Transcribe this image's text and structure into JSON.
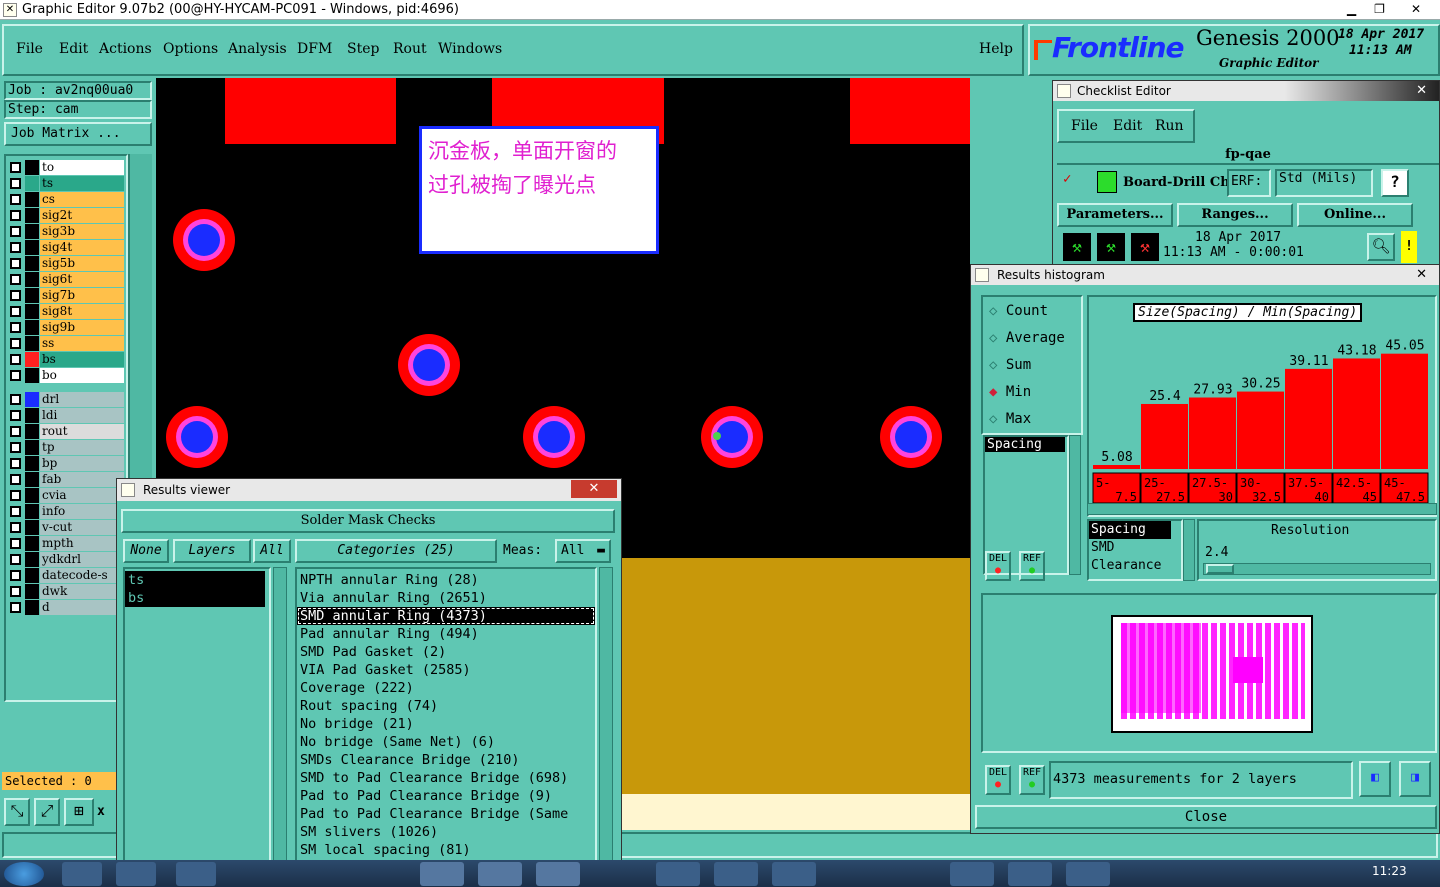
{
  "window": {
    "title": "Graphic Editor 9.07b2 (00@HY-HYCAM-PC091 - Windows, pid:4696)"
  },
  "menu": {
    "file": "File",
    "edit": "Edit",
    "actions": "Actions",
    "options": "Options",
    "analysis": "Analysis",
    "dfm": "DFM",
    "step": "Step",
    "rout": "Rout",
    "windows": "Windows",
    "help": "Help"
  },
  "brand": {
    "logo": "Frontline",
    "product": "Genesis 2000",
    "subtitle": "Graphic Editor",
    "date": "18 Apr 2017",
    "time": "11:13 AM"
  },
  "job": {
    "job_line": "Job : av2nq00ua0",
    "step_line": "Step: cam",
    "matrix_button": "Job Matrix ..."
  },
  "layers": {
    "group1": [
      {
        "name": "to",
        "color": "#ffffff",
        "swatch": "#000000"
      },
      {
        "name": "ts",
        "color": "#2aa88a",
        "swatch": "#2aa88a"
      },
      {
        "name": "cs",
        "color": "#ffc04a",
        "swatch": "#000000"
      },
      {
        "name": "sig2t",
        "color": "#ffc04a",
        "swatch": "#000000"
      },
      {
        "name": "sig3b",
        "color": "#ffc04a",
        "swatch": "#000000"
      },
      {
        "name": "sig4t",
        "color": "#ffc04a",
        "swatch": "#000000"
      },
      {
        "name": "sig5b",
        "color": "#ffc04a",
        "swatch": "#000000"
      },
      {
        "name": "sig6t",
        "color": "#ffc04a",
        "swatch": "#000000"
      },
      {
        "name": "sig7b",
        "color": "#ffc04a",
        "swatch": "#000000"
      },
      {
        "name": "sig8t",
        "color": "#ffc04a",
        "swatch": "#000000"
      },
      {
        "name": "sig9b",
        "color": "#ffc04a",
        "swatch": "#000000"
      },
      {
        "name": "ss",
        "color": "#ffc04a",
        "swatch": "#000000"
      },
      {
        "name": "bs",
        "color": "#2aa88a",
        "swatch": "#ff2020"
      },
      {
        "name": "bo",
        "color": "#ffffff",
        "swatch": "#000000"
      }
    ],
    "group2": [
      {
        "name": "drl",
        "color": "#a8c4c4",
        "swatch": "#1a2cff"
      },
      {
        "name": "ldi",
        "color": "#a8c4c4",
        "swatch": "#000000"
      },
      {
        "name": "rout",
        "color": "#dcdcdc",
        "swatch": "#000000"
      }
    ],
    "group3": [
      {
        "name": "tp",
        "color": "#a8c4c4",
        "swatch": "#000000"
      },
      {
        "name": "bp",
        "color": "#a8c4c4",
        "swatch": "#000000"
      },
      {
        "name": "fab",
        "color": "#a8c4c4",
        "swatch": "#000000"
      },
      {
        "name": "cvia",
        "color": "#a8c4c4",
        "swatch": "#000000"
      },
      {
        "name": "info",
        "color": "#a8c4c4",
        "swatch": "#000000"
      },
      {
        "name": "v-cut",
        "color": "#a8c4c4",
        "swatch": "#000000"
      },
      {
        "name": "mpth",
        "color": "#a8c4c4",
        "swatch": "#000000"
      },
      {
        "name": "ydkdrl",
        "color": "#a8c4c4",
        "swatch": "#000000"
      },
      {
        "name": "datecode-s",
        "color": "#a8c4c4",
        "swatch": "#000000"
      },
      {
        "name": "dwk",
        "color": "#a8c4c4",
        "swatch": "#000000"
      },
      {
        "name": "d",
        "color": "#a8c4c4",
        "swatch": "#000000"
      }
    ]
  },
  "selected": {
    "label": "Selected : 0"
  },
  "annotation": {
    "line1": "沉金板，单面开窗的",
    "line2": "过孔被掏了曝光点"
  },
  "checklist": {
    "title": "Checklist Editor",
    "menu": {
      "file": "File",
      "edit": "Edit",
      "run": "Run"
    },
    "name": "fp-qae",
    "action": "Board-Drill Che",
    "erf_label": "ERF:",
    "erf_value": "Std (Mils)",
    "help": "?",
    "parameters": "Parameters...",
    "ranges": "Ranges...",
    "online": "Online...",
    "run_date": "18 Apr 2017",
    "run_time": "11:13 AM - 0:00:01",
    "warning": "!"
  },
  "histogram": {
    "title": "Results histogram",
    "modes": [
      {
        "label": "Count",
        "selected": false
      },
      {
        "label": "Average",
        "selected": false
      },
      {
        "label": "Sum",
        "selected": false
      },
      {
        "label": "Min",
        "selected": true
      },
      {
        "label": "Max",
        "selected": false
      }
    ],
    "category_list": [
      "Spacing"
    ],
    "metric_list": [
      "Spacing",
      "SMD",
      "Clearance"
    ],
    "resolution_label": "Resolution",
    "resolution_value": "2.4",
    "del": "DEL",
    "ref": "REF",
    "summary": "4373 measurements for 2 layers",
    "close": "Close"
  },
  "chart_data": {
    "type": "bar",
    "title": "Size(Spacing) / Min(Spacing)",
    "categories": [
      "5-7.5",
      "25-27.5",
      "27.5-30",
      "30-32.5",
      "37.5-40",
      "42.5-45",
      "45-47.5"
    ],
    "values": [
      5.08,
      25.4,
      27.93,
      30.25,
      39.11,
      43.18,
      45.05
    ],
    "value_labels": [
      "5.08",
      "25.4",
      "27.93",
      "30.25",
      "39.11",
      "43.18",
      "45.05"
    ],
    "ylim": [
      0,
      50
    ],
    "bar_color": "#ff0000"
  },
  "results": {
    "title": "Results viewer",
    "header": "Solder Mask Checks",
    "none": "None",
    "layers": "Layers",
    "all": "All",
    "categories_label": "Categories (25)",
    "meas_label": "Meas:",
    "meas_value": "All",
    "layer_items": [
      "ts",
      "bs"
    ],
    "items": [
      {
        "label": "NPTH annular Ring (28)",
        "selected": false
      },
      {
        "label": "Via annular Ring (2651)",
        "selected": false
      },
      {
        "label": "SMD annular Ring (4373)",
        "selected": true
      },
      {
        "label": "Pad annular Ring (494)",
        "selected": false
      },
      {
        "label": "SMD Pad Gasket (2)",
        "selected": false
      },
      {
        "label": "VIA Pad Gasket (2585)",
        "selected": false
      },
      {
        "label": "Coverage (222)",
        "selected": false
      },
      {
        "label": "Rout spacing (74)",
        "selected": false
      },
      {
        "label": "No bridge (21)",
        "selected": false
      },
      {
        "label": "No bridge (Same Net) (6)",
        "selected": false
      },
      {
        "label": "SMDs Clearance Bridge (210)",
        "selected": false
      },
      {
        "label": "SMD to Pad Clearance Bridge (698)",
        "selected": false
      },
      {
        "label": "Pad to Pad Clearance Bridge (9)",
        "selected": false
      },
      {
        "label": "Pad to Pad Clearance Bridge (Same",
        "selected": false
      },
      {
        "label": "SM slivers (1026)",
        "selected": false
      },
      {
        "label": "SM local spacing (81)",
        "selected": false
      }
    ]
  },
  "taskbar": {
    "clock": "11:23"
  }
}
